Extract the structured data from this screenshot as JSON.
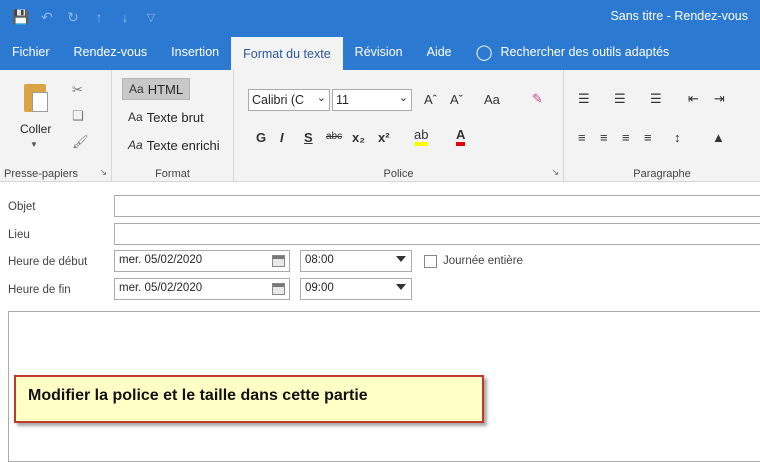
{
  "window": {
    "title": "Sans titre  -  Rendez-vous"
  },
  "quick_access": {
    "icons": [
      "save-icon",
      "undo-icon",
      "redo-icon",
      "up-arrow-icon",
      "down-arrow-icon",
      "customize-dropdown-icon"
    ]
  },
  "tabs": [
    {
      "label": "Fichier"
    },
    {
      "label": "Rendez-vous"
    },
    {
      "label": "Insertion"
    },
    {
      "label": "Format du texte"
    },
    {
      "label": "Révision"
    },
    {
      "label": "Aide"
    }
  ],
  "search": {
    "label": "Rechercher des outils adaptés"
  },
  "ribbon": {
    "clipboard": {
      "paste_label": "Coller",
      "group_label": "Presse-papiers"
    },
    "format": {
      "html": "HTML",
      "plain": "Texte brut",
      "rich": "Texte enrichi",
      "prefix": "Aa",
      "group_label": "Format"
    },
    "font": {
      "name": "Calibri (C",
      "size": "11",
      "grow": "Aˆ",
      "shrink": "Aˇ",
      "case": "Aa",
      "group_label": "Police",
      "bold": "G",
      "italic": "I",
      "underline": "S",
      "strike": "abc",
      "subscript": "x₂",
      "superscript": "x²",
      "highlight": "ab",
      "fontcolor": "A"
    },
    "paragraph": {
      "group_label": "Paragraphe"
    }
  },
  "form": {
    "subject_label": "Objet",
    "location_label": "Lieu",
    "start_label": "Heure de début",
    "end_label": "Heure de fin",
    "start_date": "mer. 05/02/2020",
    "end_date": "mer. 05/02/2020",
    "start_time": "08:00",
    "end_time": "09:00",
    "allday_label": "Journée entière"
  },
  "callout": {
    "text": "Modifier la police et le taille dans cette partie"
  },
  "colors": {
    "accent": "#2b79d0",
    "callout_bg": "#ffffc6",
    "callout_border": "#c0392b"
  }
}
